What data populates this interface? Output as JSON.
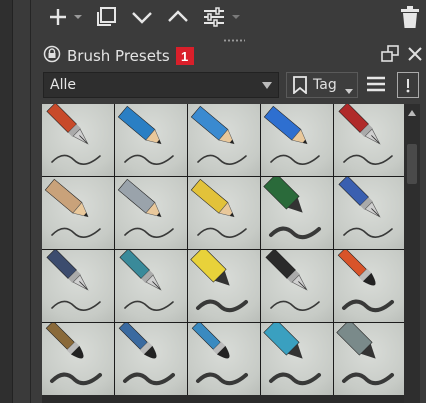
{
  "toolbar": {
    "icons": [
      "plus-icon",
      "chevron-small-icon",
      "copy-icon",
      "chevron-down-icon",
      "chevron-up-icon",
      "sliders-icon",
      "trash-icon"
    ]
  },
  "panel": {
    "title": "Brush Presets",
    "badge": "1"
  },
  "filter": {
    "selected": "Alle",
    "tag_label": "Tag"
  },
  "presets": [
    {
      "tool": "fountain-pen",
      "color": "#c84a2a"
    },
    {
      "tool": "pencil",
      "color": "#2a7fc4"
    },
    {
      "tool": "pencil",
      "color": "#3a8ad0"
    },
    {
      "tool": "pencil",
      "color": "#2e6fd0"
    },
    {
      "tool": "pen",
      "color": "#b02a2a"
    },
    {
      "tool": "pencil",
      "color": "#c9a27a"
    },
    {
      "tool": "pencil",
      "color": "#9aa3ab"
    },
    {
      "tool": "pencil",
      "color": "#e2c23a"
    },
    {
      "tool": "marker",
      "color": "#2a6a3a"
    },
    {
      "tool": "fountain-pen",
      "color": "#3a5fb0"
    },
    {
      "tool": "pen",
      "color": "#3c4c6e"
    },
    {
      "tool": "pen",
      "color": "#3a8a9a"
    },
    {
      "tool": "marker",
      "color": "#e8d23a"
    },
    {
      "tool": "fountain-pen",
      "color": "#2a2a2a"
    },
    {
      "tool": "brush",
      "color": "#d8542a"
    },
    {
      "tool": "brush",
      "color": "#8a6a3a"
    },
    {
      "tool": "brush",
      "color": "#3a6aa0"
    },
    {
      "tool": "brush",
      "color": "#3a8ac0"
    },
    {
      "tool": "marker",
      "color": "#3aa0c0"
    },
    {
      "tool": "marker",
      "color": "#7a8a8a"
    }
  ]
}
